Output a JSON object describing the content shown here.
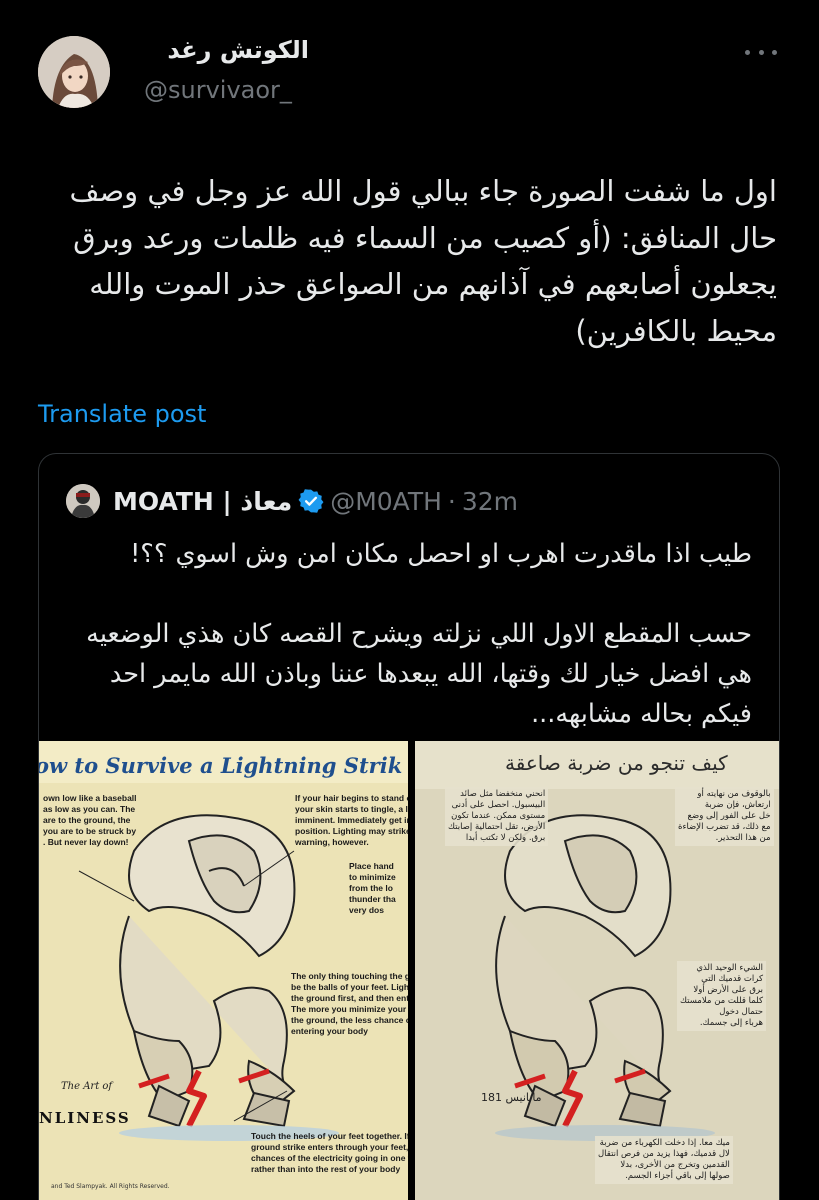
{
  "post": {
    "display_name": "الكوتش رغد",
    "handle": "@survivaor_",
    "text": "اول ما شفت الصورة جاء ببالي قول الله عز وجل في وصف حال المنافق: (أو كصيب من السماء فيه ظلمات ورعد وبرق يجعلون أصابعهم في آذانهم من الصواعق حذر الموت والله محيط بالكافرين)",
    "translate_label": "Translate post",
    "more_icon": "more-horizontal-icon"
  },
  "quote": {
    "name": "MOATH | معاذ",
    "handle": "@M0ATH",
    "separator": "·",
    "time": "32m",
    "verified_icon": "verified-badge-icon",
    "text_1": "طيب اذا ماقدرت اهرب او احصل مكان امن وش اسوي ؟؟!",
    "text_2": "حسب المقطع الاول اللي نزلته ويشرح القصه كان هذي الوضعيه هي افضل خيار لك وقتها، الله يبعدها عننا وباذن الله مايمر احد فيكم بحاله مشابهه...",
    "verified_color": "#1d9bf0"
  },
  "images": {
    "left": {
      "title": "ow to Survive a Lightning Strik",
      "captions": [
        "own low like a baseball\nas low as you can. The\nare to the ground, the\nyou are to be struck by\n. But never lay down!",
        "If your hair begins to stand o\nyour skin starts to tingle, a lighti\nimminent. Immediately get into th\nposition. Lighting may strike w\nwarning, however.",
        "Place hand\nto minimize\nfrom the lo\nthunder tha\nvery dos",
        "The only thing touching the gr\nbe the balls of your feet. Light\nthe ground first, and then ente\nThe more you minimize your c\nthe ground, the less chance o\nentering your body",
        "Touch the heels of your feet together. If electri\nground strike enters through your feet, this inc\nchances of the electricity going in one foot and o\nrather than into the rest of your body"
      ],
      "brand_sub": "The Art of",
      "brand": "NLINESS",
      "credit": "and Ted Slampyak. All Rights Reserved."
    },
    "right": {
      "title": "كيف تنجو من ضربة صاعقة",
      "captions": [
        "انحني منخفضا مثل صائد\nالبيسبول. احصل على أدنى\nمستوى ممكن. عندما تكون\nالأرض، تقل احتمالية إصابتك\nبرق. ولكن لا تكتب أبدا",
        "بالوقوف من نهايته أو\nارتعاش، فإن ضربة\nخل على الفور إلى وضع\nمع ذلك، قد تضرب الإضاءة\nمن هذا التحذير.",
        "الشيء الوحيد الذي\nكرات قدميك التي\nبرق على الأرض أولا\nكلما قللت من ملامستك\nحتمال دخول\nهرباء إلى جسمك.",
        "ميك معا. إذا دخلت الكهرباء من ضربة\nلال قدميك، فهذا يزيد من فرص انتقال\nالقدمين وتخرج من الأخرى، بدلا\nصولها إلى باقي أجزاء الجسم."
      ],
      "page_number": "181 مانانيس"
    }
  }
}
